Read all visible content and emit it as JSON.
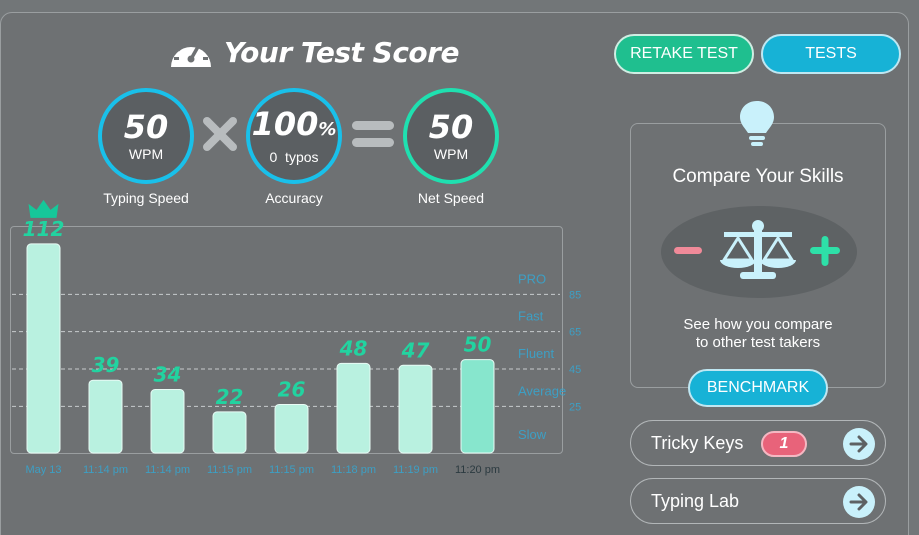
{
  "title": "Your Test Score",
  "buttons": {
    "retake": "RETAKE TEST",
    "tests": "TESTS",
    "benchmark": "BENCHMARK"
  },
  "stats": {
    "typing_speed": {
      "value": "50",
      "unit": "WPM",
      "caption": "Typing Speed"
    },
    "accuracy": {
      "value": "100",
      "percent": "%",
      "unit": "0  typos",
      "caption": "Accuracy"
    },
    "net_speed": {
      "value": "50",
      "unit": "WPM",
      "caption": "Net Speed"
    }
  },
  "compare": {
    "title": "Compare Your Skills",
    "desc_line1": "See how you compare",
    "desc_line2": "to other test takers"
  },
  "rows": {
    "tricky_keys": {
      "label": "Tricky Keys",
      "count": "1"
    },
    "typing_lab": {
      "label": "Typing Lab"
    }
  },
  "colors": {
    "bar": "#b9f1e0",
    "bar_last": "#87e6cd",
    "value_label": "#22d3a0",
    "level_label": "#3d9fc4",
    "crown": "#16c79a"
  },
  "chart_data": {
    "type": "bar",
    "categories": [
      "May 13",
      "11:14 pm",
      "11:14 pm",
      "11:15 pm",
      "11:15 pm",
      "11:18 pm",
      "11:19 pm",
      "11:20 pm"
    ],
    "values": [
      112,
      39,
      34,
      22,
      26,
      48,
      47,
      50
    ],
    "ylim": [
      0,
      120
    ],
    "reference_lines": [
      {
        "value": 85,
        "label": "PRO"
      },
      {
        "value": 65,
        "label": "Fast"
      },
      {
        "value": 45,
        "label": "Fluent"
      },
      {
        "value": 25,
        "label": "Average"
      }
    ],
    "bottom_label": "Slow",
    "highlight_index": 7,
    "top_index": 0
  }
}
